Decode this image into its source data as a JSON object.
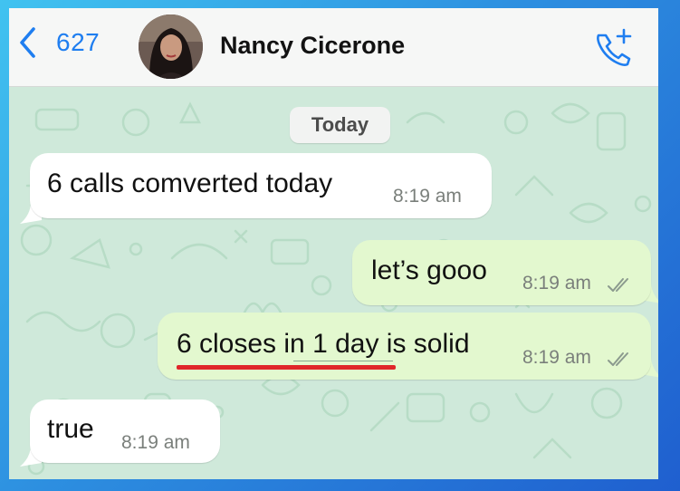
{
  "header": {
    "back_count": "627",
    "contact_name": "Nancy Cicerone"
  },
  "date_divider": "Today",
  "messages": [
    {
      "direction": "incoming",
      "text": "6 calls comverted today",
      "time": "8:19 am"
    },
    {
      "direction": "outgoing",
      "text": "let’s gooo",
      "time": "8:19 am",
      "status": "read"
    },
    {
      "direction": "outgoing",
      "text_highlight": "6 closes in 1 day",
      "text_rest": " is solid",
      "time": "8:19 am",
      "status": "read"
    },
    {
      "direction": "incoming",
      "text": "true",
      "time": "8:19 am"
    }
  ],
  "colors": {
    "accent": "#1f7ef0",
    "wallpaper": "#cfe9da",
    "incoming_bubble": "#ffffff",
    "outgoing_bubble": "#e3f8cf",
    "annotation_underline": "#e0262a"
  },
  "icons": {
    "back": "chevron-left-icon",
    "call": "add-call-icon",
    "read_receipt": "double-check-icon"
  }
}
